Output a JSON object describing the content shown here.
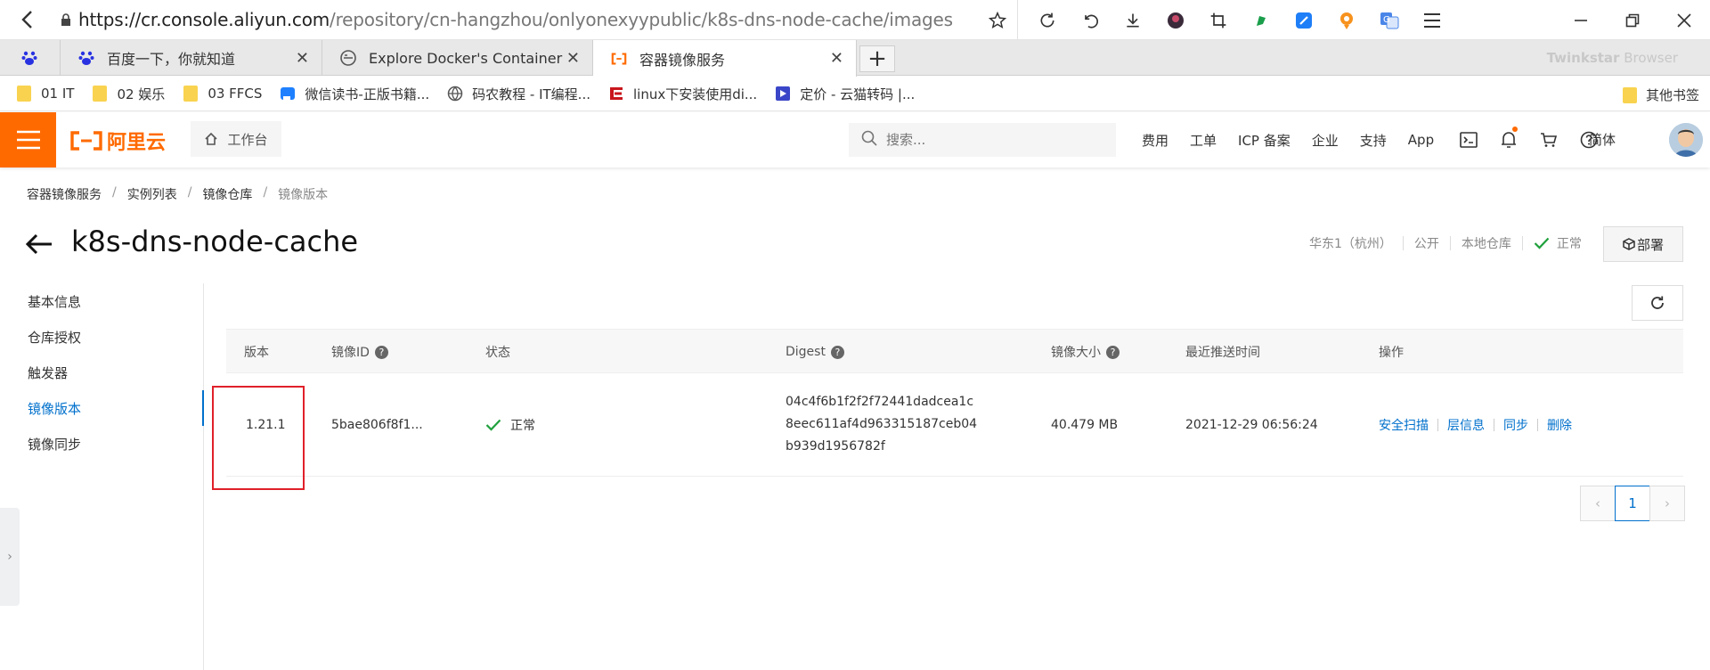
{
  "browser": {
    "url_host": "https://cr.console.aliyun.com",
    "url_path": "/repository/cn-hangzhou/onlyonexyypublic/k8s-dns-node-cache/images",
    "brand": "Twinkstar",
    "brand_suffix": " Browser",
    "tabs": [
      {
        "title": "百度一下，你就知道",
        "icon": "baidu-paw-icon"
      },
      {
        "title": "Explore Docker's Container I",
        "icon": "docker-icon"
      },
      {
        "title": "容器镜像服务",
        "icon": "aliyun-icon"
      }
    ],
    "bookmarks": [
      {
        "label": "01 IT",
        "icon": "folder-icon"
      },
      {
        "label": "02 娱乐",
        "icon": "folder-icon"
      },
      {
        "label": "03 FFCS",
        "icon": "folder-icon"
      },
      {
        "label": "微信读书-正版书籍...",
        "icon": "weread-icon"
      },
      {
        "label": "码农教程 - IT编程...",
        "icon": "globe-icon"
      },
      {
        "label": "linux下安装使用di...",
        "icon": "csdn-icon"
      },
      {
        "label": "定价 - 云猫转码 |...",
        "icon": "yunmao-icon"
      }
    ],
    "other_bookmarks": "其他书签"
  },
  "topnav": {
    "logo_text": "阿里云",
    "workbench": "工作台",
    "search_placeholder": "搜索...",
    "links": [
      "费用",
      "工单",
      "ICP 备案",
      "企业",
      "支持",
      "App"
    ],
    "language": "简体"
  },
  "page": {
    "breadcrumb": [
      "容器镜像服务",
      "实例列表",
      "镜像仓库",
      "镜像版本"
    ],
    "title": "k8s-dns-node-cache",
    "region": "华东1（杭州）",
    "visibility": "公开",
    "repo_type": "本地仓库",
    "status": "正常",
    "deploy": "部署"
  },
  "sidebar": {
    "items": [
      {
        "label": "基本信息",
        "active": false
      },
      {
        "label": "仓库授权",
        "active": false
      },
      {
        "label": "触发器",
        "active": false
      },
      {
        "label": "镜像版本",
        "active": true
      },
      {
        "label": "镜像同步",
        "active": false
      }
    ]
  },
  "table": {
    "headers": {
      "version": "版本",
      "image_id": "镜像ID",
      "status": "状态",
      "digest": "Digest",
      "size": "镜像大小",
      "pushed": "最近推送时间",
      "ops": "操作"
    },
    "rows": [
      {
        "version": "1.21.1",
        "image_id": "5bae806f8f1...",
        "status": "正常",
        "digest_line1": "04c4f6b1f2f2f72441dadcea1c",
        "digest_line2": "8eec611af4d963315187ceb04",
        "digest_line3": "b939d1956782f",
        "size": "40.479 MB",
        "pushed": "2021-12-29 06:56:24",
        "actions": [
          "安全扫描",
          "层信息",
          "同步",
          "删除"
        ]
      }
    ]
  },
  "pagination": {
    "current": "1"
  },
  "colors": {
    "accent": "#ff6a00",
    "link": "#0070cc",
    "ok": "#1fa03c",
    "highlight": "#e0202a"
  }
}
